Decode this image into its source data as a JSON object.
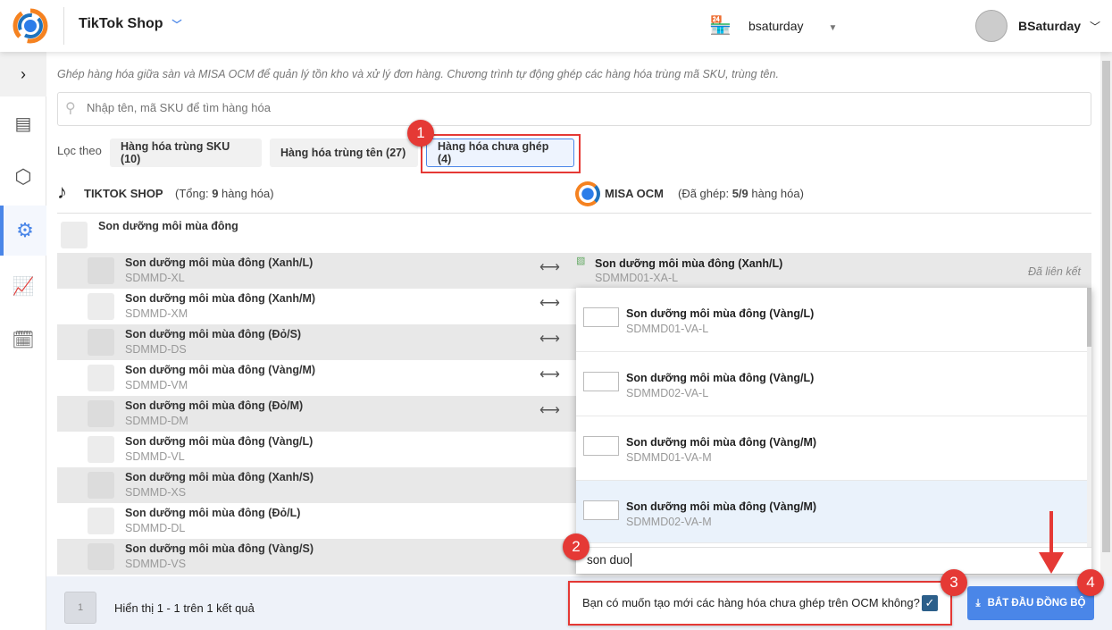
{
  "header": {
    "shop_name": "TikTok Shop",
    "store": "bsaturday",
    "user": "BSaturday"
  },
  "intro": "Ghép hàng hóa giữa sàn và MISA OCM để quản lý tồn kho và xử lý đơn hàng. Chương trình tự động ghép các hàng hóa trùng mã SKU, trùng tên.",
  "search": {
    "placeholder": "Nhập tên, mã SKU để tìm hàng hóa"
  },
  "filter": {
    "label": "Lọc theo",
    "options": [
      "Hàng hóa trùng SKU (10)",
      "Hàng hóa trùng tên (27)",
      "Hàng hóa chưa ghép (4)"
    ]
  },
  "left": {
    "title": "TIKTOK SHOP",
    "total_prefix": "(Tổng: ",
    "total": "9",
    "total_suffix": " hàng hóa)"
  },
  "right": {
    "title": "MISA OCM",
    "matched_prefix": "(Đã ghép: ",
    "matched": "5/9",
    "matched_suffix": " hàng hóa)"
  },
  "group": "Son dưỡng môi mùa đông",
  "rows": [
    {
      "name": "Son dưỡng môi mùa đông (Xanh/L)",
      "sku": "SDMMD-XL",
      "linked": true
    },
    {
      "name": "Son dưỡng môi mùa đông (Xanh/M)",
      "sku": "SDMMD-XM",
      "linked": true
    },
    {
      "name": "Son dưỡng môi mùa đông (Đỏ/S)",
      "sku": "SDMMD-DS",
      "linked": true
    },
    {
      "name": "Son dưỡng môi mùa đông (Vàng/M)",
      "sku": "SDMMD-VM",
      "linked": true
    },
    {
      "name": "Son dưỡng môi mùa đông (Đỏ/M)",
      "sku": "SDMMD-DM",
      "linked": true
    },
    {
      "name": "Son dưỡng môi mùa đông (Vàng/L)",
      "sku": "SDMMD-VL",
      "linked": false
    },
    {
      "name": "Son dưỡng môi mùa đông (Xanh/S)",
      "sku": "SDMMD-XS",
      "linked": false
    },
    {
      "name": "Son dưỡng môi mùa đông (Đỏ/L)",
      "sku": "SDMMD-DL",
      "linked": false
    },
    {
      "name": "Son dưỡng môi mùa đông (Vàng/S)",
      "sku": "SDMMD-VS",
      "linked": false
    }
  ],
  "linked_item": {
    "name": "Son dưỡng môi mùa đông (Xanh/L)",
    "sku": "SDMMD01-XA-L",
    "status": "Đã liên kết"
  },
  "dropdown": {
    "items": [
      {
        "name": "Son dưỡng môi mùa đông (Vàng/L)",
        "sku": "SDMMD01-VA-L"
      },
      {
        "name": "Son dưỡng môi mùa đông (Vàng/L)",
        "sku": "SDMMD02-VA-L"
      },
      {
        "name": "Son dưỡng môi mùa đông (Vàng/M)",
        "sku": "SDMMD01-VA-M"
      },
      {
        "name": "Son dưỡng môi mùa đông (Vàng/M)",
        "sku": "SDMMD02-VA-M"
      }
    ],
    "input": "son duo"
  },
  "footer": {
    "page": "1",
    "summary": "Hiển thị 1 - 1 trên 1 kết quả",
    "create_question": "Bạn có muốn tạo mới các hàng hóa chưa ghép trên OCM không?",
    "create_checked": true,
    "sync_button": "BẮT ĐẦU ĐỒNG BỘ"
  },
  "badges": [
    "1",
    "2",
    "3",
    "4"
  ],
  "colors": {
    "accent": "#4a86e8",
    "annotation": "#e53935"
  }
}
